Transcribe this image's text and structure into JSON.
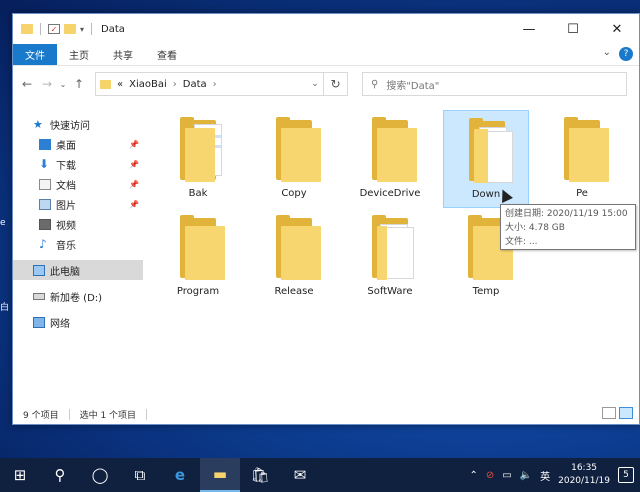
{
  "window": {
    "title": "Data"
  },
  "ribbon": {
    "tabs": [
      "文件",
      "主页",
      "共享",
      "查看"
    ]
  },
  "address": {
    "overflow": "«",
    "crumbs": [
      "XiaoBai",
      "Data"
    ]
  },
  "search": {
    "placeholder": "搜索\"Data\""
  },
  "nav": {
    "quick_access": "快速访问",
    "items": [
      "桌面",
      "下载",
      "文档",
      "图片",
      "视频",
      "音乐"
    ],
    "this_pc": "此电脑",
    "drive": "新加卷 (D:)",
    "network": "网络"
  },
  "folders": [
    "Bak",
    "Copy",
    "DeviceDrive",
    "Down",
    "Pe",
    "Program",
    "Release",
    "SoftWare",
    "Temp"
  ],
  "tooltip": {
    "created": "创建日期: 2020/11/19 15:00",
    "size": "大小: 4.78 GB",
    "files": "文件: ..."
  },
  "status": {
    "count": "9 个项目",
    "selected": "选中 1 个项目"
  },
  "taskbar": {
    "time": "16:35",
    "date": "2020/11/19",
    "ime": "英",
    "notifications": "5"
  },
  "colors": {
    "accent": "#1979ca",
    "folder": "#f8d66f",
    "selection": "#cce8ff"
  }
}
